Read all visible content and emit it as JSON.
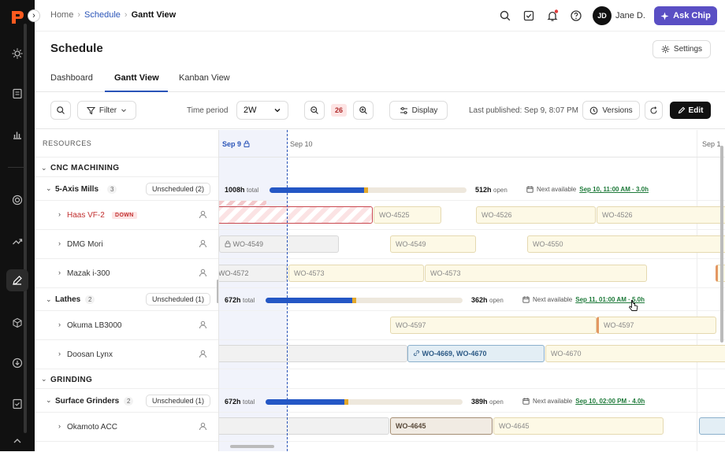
{
  "breadcrumb": {
    "home": "Home",
    "schedule": "Schedule",
    "current": "Gantt View"
  },
  "user": {
    "initials": "JD",
    "name": "Jane D."
  },
  "ask_button": "Ask Chip",
  "page_title": "Schedule",
  "settings_label": "Settings",
  "tabs": [
    "Dashboard",
    "Gantt View",
    "Kanban View"
  ],
  "toolbar": {
    "filter": "Filter",
    "time_period_label": "Time period",
    "time_period_value": "2W",
    "zoom_value": "26",
    "display": "Display",
    "last_published": "Last published: Sep 9, 8:07 PM",
    "versions": "Versions",
    "edit": "Edit"
  },
  "resources_header": "RESOURCES",
  "dates": {
    "d1": "Sep 9",
    "d2": "Sep 10",
    "d3": "Sep 1"
  },
  "resources": {
    "cnc": {
      "label": "CNC MACHINING"
    },
    "five_axis": {
      "label": "5-Axis Mills",
      "count": "3",
      "unscheduled": "Unscheduled (2)",
      "total": "1008h",
      "open": "512h",
      "next_label": "Next available",
      "next_value": "Sep 10, 11:00 AM · 3.0h",
      "fill_pct": 0.48,
      "warn_pct": 0.02
    },
    "haas": {
      "label": "Haas VF-2",
      "status": "DOWN"
    },
    "dmg": {
      "label": "DMG Mori"
    },
    "mazak": {
      "label": "Mazak i-300"
    },
    "lathes": {
      "label": "Lathes",
      "count": "2",
      "unscheduled": "Unscheduled (1)",
      "total": "672h",
      "open": "362h",
      "next_label": "Next available",
      "next_value": "Sep 11, 01:00 AM · 5.0h",
      "fill_pct": 0.44,
      "warn_pct": 0.02
    },
    "okuma": {
      "label": "Okuma LB3000"
    },
    "doosan": {
      "label": "Doosan Lynx"
    },
    "grinding": {
      "label": "GRINDING"
    },
    "surface": {
      "label": "Surface Grinders",
      "count": "2",
      "unscheduled": "Unscheduled (1)",
      "total": "672h",
      "open": "389h",
      "next_label": "Next available",
      "next_value": "Sep 10, 02:00 PM · 4.0h",
      "fill_pct": 0.4,
      "warn_pct": 0.02
    },
    "okamoto": {
      "label": "Okamoto ACC"
    }
  },
  "total_suffix": "total",
  "open_suffix": "open",
  "work_orders": {
    "w4525": "WO-4525",
    "w4526a": "WO-4526",
    "w4526b": "WO-4526",
    "w4549a": "WO-4549",
    "w4549b": "WO-4549",
    "w4550": "WO-4550",
    "w4572": "WO-4572",
    "w4573a": "WO-4573",
    "w4573b": "WO-4573",
    "w4597a": "WO-4597",
    "w4597b": "WO-4597",
    "w4669": "WO-4669, WO-4670",
    "w4670": "WO-4670",
    "w4645a": "WO-4645",
    "w4645b": "WO-4645"
  },
  "colors": {
    "accent": "#5a4fc4",
    "link": "#2a54b8",
    "down": "#c12f2f",
    "capacity": "#2457c5",
    "next": "#1e7a3a"
  }
}
